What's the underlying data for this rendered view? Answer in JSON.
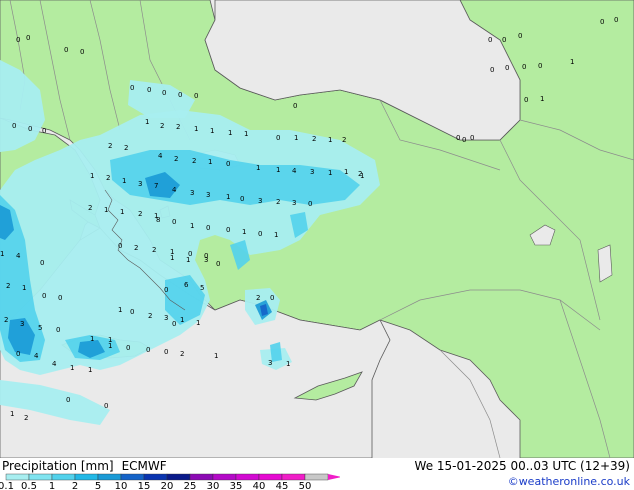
{
  "title": {
    "label": "Precipitation [mm]",
    "model": "ECMWF"
  },
  "datetime": "We 15-01-2025 00..03 UTC (12+39)",
  "credit": "©weatheronline.co.uk",
  "legend": {
    "labels": [
      "0.1",
      "0.5",
      "1",
      "2",
      "5",
      "10",
      "15",
      "20",
      "25",
      "30",
      "35",
      "40",
      "45",
      "50"
    ],
    "colors": [
      "#a8eef0",
      "#80e4f0",
      "#52d2ec",
      "#22b8e6",
      "#1a9ad6",
      "#1463c8",
      "#0a34b0",
      "#0a1a8a",
      "#8c0ab4",
      "#b40ac8",
      "#d20ad2",
      "#e60ad2",
      "#f01ec8",
      "#c8c8c8"
    ]
  },
  "colors": {
    "sea": "#eaeaea",
    "land": "#b4eca0",
    "border": "#8c8c8c",
    "coast": "#5a5a5a",
    "precip_light": "#a8eef0",
    "precip_mid": "#52d2ec",
    "precip_heavy": "#1a9ad6"
  },
  "map_values": [
    "0",
    "0",
    "0",
    "0",
    "0",
    "0",
    "0",
    "0",
    "0",
    "1",
    "0",
    "1",
    "0",
    "0",
    "0",
    "0",
    "0",
    "0",
    "0",
    "0",
    "0",
    "0",
    "0",
    "0",
    "0",
    "0",
    "0",
    "0",
    "1",
    "2",
    "2",
    "1",
    "1",
    "1",
    "1",
    "2",
    "2",
    "4",
    "2",
    "2",
    "1",
    "0",
    "1",
    "2",
    "1",
    "3",
    "7",
    "4",
    "3",
    "3",
    "1",
    "0",
    "1",
    "1",
    "4",
    "3",
    "1",
    "1",
    "2",
    "0",
    "1",
    "2",
    "1",
    "2",
    "1",
    "3",
    "2",
    "3",
    "0",
    "2",
    "1",
    "1",
    "2",
    "1",
    "8",
    "0",
    "1",
    "0",
    "0",
    "1",
    "0",
    "1",
    "0",
    "2",
    "2",
    "1",
    "0",
    "0",
    "1",
    "1",
    "3",
    "0",
    "1",
    "4",
    "0",
    "2",
    "1",
    "0",
    "0",
    "1",
    "0",
    "2",
    "3",
    "2",
    "0",
    "2",
    "3",
    "5",
    "0",
    "1",
    "1",
    "1",
    "1",
    "6",
    "5",
    "0",
    "4",
    "4",
    "1",
    "1",
    "1",
    "0",
    "0",
    "0",
    "2",
    "1",
    "3",
    "1",
    "0",
    "0",
    "0",
    "0",
    "1",
    "2"
  ]
}
